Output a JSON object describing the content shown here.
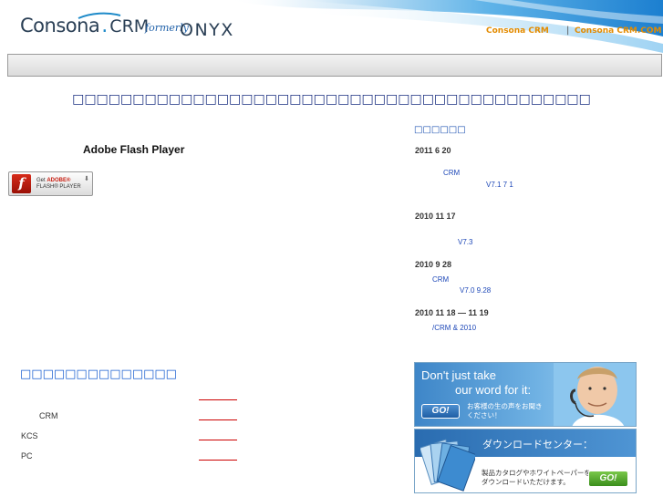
{
  "header": {
    "logo": {
      "consona": "Consona",
      "crm": "CRM",
      "formerly": "formerly",
      "onyx": "ONYX"
    },
    "links": [
      "Consona CRM",
      "Consona CRM.COM"
    ],
    "separator": "|"
  },
  "main_title": "□□□□□□□□□□□□□□□□□□□□□□□□□□□□□□□□□□□□□□□□□□□",
  "left": {
    "flash_heading": "Adobe Flash Player",
    "flash_button": {
      "icon_letter": "f",
      "line1_prefix": "Get ",
      "line1_brand": "ADOBE®",
      "line2": "FLASH® PLAYER",
      "arrow": "⬇"
    },
    "support_heading": "□□□□□□□□□□□□□□",
    "support_rows": [
      "CRM",
      "KCS",
      "PC"
    ]
  },
  "news": {
    "heading": "□□□□□□",
    "items": [
      {
        "date": "2011  6  20",
        "lines": [
          "CRM",
          "V7.1    7  1"
        ]
      },
      {
        "date": "2010  11  17",
        "lines": [
          "V7.3"
        ]
      },
      {
        "date": "2010  9  28",
        "lines": [
          "CRM",
          "V7.0  9.28"
        ]
      },
      {
        "date": "2010  11  18   — 11  19",
        "lines": [
          "/CRM   &        2010"
        ]
      }
    ]
  },
  "banners": {
    "b1": {
      "line1": "Don't just take",
      "line2": "our word for it:",
      "go": "GO!",
      "sub1": "お客様の生の声をお聞き",
      "sub2": "ください！"
    },
    "b2": {
      "title": "ダウンロードセンター：",
      "go": "GO!",
      "sub1": "製品カタログやホワイトペーパーを",
      "sub2": "ダウンロードいただけます。"
    }
  },
  "colors": {
    "accent_orange": "#e38b00",
    "title_blue": "#1a2f80",
    "link_blue": "#1f49b8",
    "rule_red": "#cc0000"
  }
}
